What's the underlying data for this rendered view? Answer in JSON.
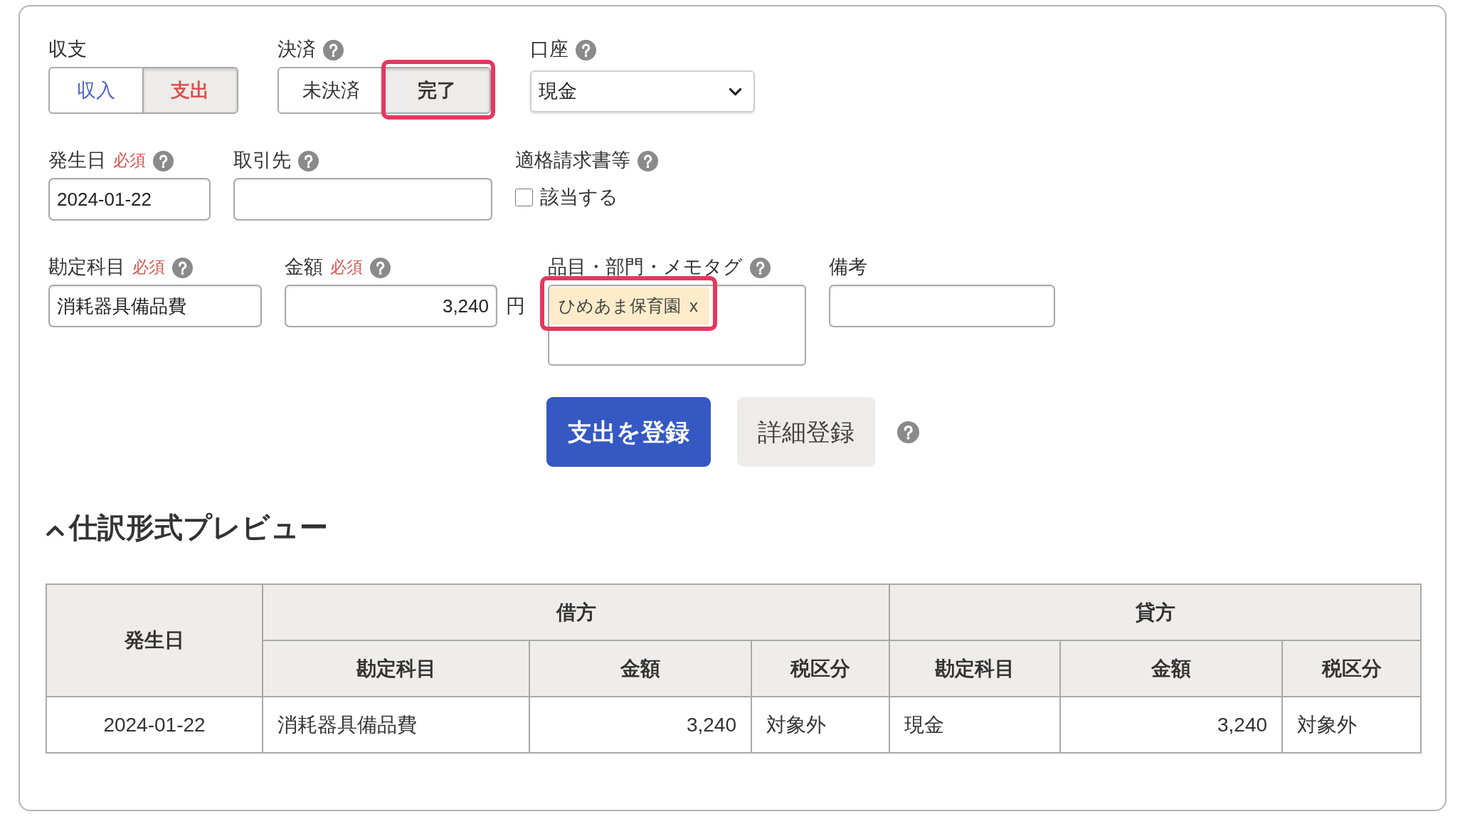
{
  "form": {
    "field_rows": [
      [
        {
          "kind": "segmented",
          "label": "収支",
          "help": false,
          "options": [
            {
              "label": "収入",
              "color": "#5063c8",
              "selected": false,
              "highlighted": false
            },
            {
              "label": "支出",
              "color": "#d9534f",
              "selected": true,
              "highlighted": false
            }
          ]
        },
        {
          "kind": "segmented",
          "label": "決済",
          "help": true,
          "options": [
            {
              "label": "未決済",
              "selected": false,
              "highlighted": false
            },
            {
              "label": "完了",
              "selected": true,
              "highlighted": true
            }
          ]
        },
        {
          "kind": "select",
          "label": "口座",
          "help": true,
          "value": "現金"
        }
      ],
      [
        {
          "kind": "input",
          "label": "発生日",
          "required_mark": "必須",
          "help": true,
          "value": "2024-01-22"
        },
        {
          "kind": "input",
          "label": "取引先",
          "help": true
        },
        {
          "kind": "checkbox",
          "label": "適格請求書等",
          "help": true,
          "option": {
            "label": "該当する",
            "checked": false
          }
        }
      ],
      [
        {
          "kind": "input",
          "label": "勘定科目",
          "required_mark": "必須",
          "help": true,
          "value": "消耗器具備品費"
        },
        {
          "kind": "amount",
          "label": "金額",
          "required_mark": "必須",
          "help": true,
          "value": "3,240",
          "unit": "円"
        },
        {
          "kind": "tags",
          "label": "品目・部門・メモタグ",
          "help": true,
          "tags": [
            {
              "label": "ひめあま保育園",
              "remove": "x",
              "highlighted": true
            }
          ]
        },
        {
          "kind": "input",
          "label": "備考",
          "help": false
        }
      ]
    ]
  },
  "actions": {
    "buttons": [
      {
        "label": "支出を登録",
        "kind": "primary"
      },
      {
        "label": "詳細登録",
        "kind": "secondary"
      }
    ],
    "help": true
  },
  "preview": {
    "title": "仕訳形式プレビュー",
    "expanded": true,
    "table": {
      "date_header": "発生日",
      "groups": [
        {
          "label": "借方",
          "columns": [
            {
              "label": "勘定科目",
              "kind": "text"
            },
            {
              "label": "金額",
              "kind": "amount"
            },
            {
              "label": "税区分",
              "kind": "text"
            }
          ]
        },
        {
          "label": "貸方",
          "columns": [
            {
              "label": "勘定科目",
              "kind": "text"
            },
            {
              "label": "金額",
              "kind": "amount"
            },
            {
              "label": "税区分",
              "kind": "text"
            }
          ]
        }
      ],
      "rows": [
        {
          "date": "2024-01-22",
          "cells": [
            "消耗器具備品費",
            "3,240",
            "対象外",
            "現金",
            "3,240",
            "対象外"
          ]
        }
      ]
    }
  }
}
